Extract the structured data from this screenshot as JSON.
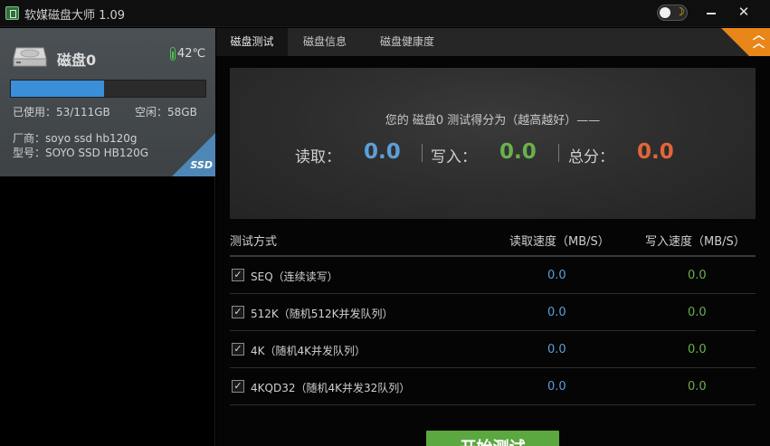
{
  "window": {
    "title": "软媒磁盘大师 1.09",
    "min_glyph": "",
    "close_glyph": "✕"
  },
  "disk": {
    "name": "磁盘0",
    "temperature": "42℃",
    "usage_fraction": 0.4775,
    "used_text": "已使用：53/111GB",
    "free_text": "空闲：58GB",
    "vendor_text": "厂商：soyo ssd hb120g",
    "model_text": "型号：SOYO SSD HB120G",
    "badge": "SSD"
  },
  "tabs": [
    {
      "label": "磁盘测试",
      "active": true
    },
    {
      "label": "磁盘信息",
      "active": false
    },
    {
      "label": "磁盘健康度",
      "active": false
    }
  ],
  "score": {
    "caption": "您的 磁盘0 测试得分为（越高越好）——",
    "read_label": "读取：",
    "read_value": "0.0",
    "write_label": "写入：",
    "write_value": "0.0",
    "total_label": "总分：",
    "total_value": "0.0"
  },
  "colors": {
    "read": "#5c9fd8",
    "write": "#6ab04c",
    "total": "#e0663a",
    "accent": "#e8861a",
    "usage": "#3a8fd8"
  },
  "table": {
    "headers": [
      "测试方式",
      "读取速度（MB/S）",
      "写入速度（MB/S）"
    ],
    "rows": [
      {
        "label": "SEQ（连续读写）",
        "read": "0.0",
        "write": "0.0",
        "checked": true
      },
      {
        "label": "512K（随机512K并发队列）",
        "read": "0.0",
        "write": "0.0",
        "checked": true
      },
      {
        "label": "4K（随机4K并发队列）",
        "read": "0.0",
        "write": "0.0",
        "checked": true
      },
      {
        "label": "4KQD32（随机4K并发32队列）",
        "read": "0.0",
        "write": "0.0",
        "checked": true
      }
    ]
  },
  "start_button": {
    "label": "开始测试"
  }
}
